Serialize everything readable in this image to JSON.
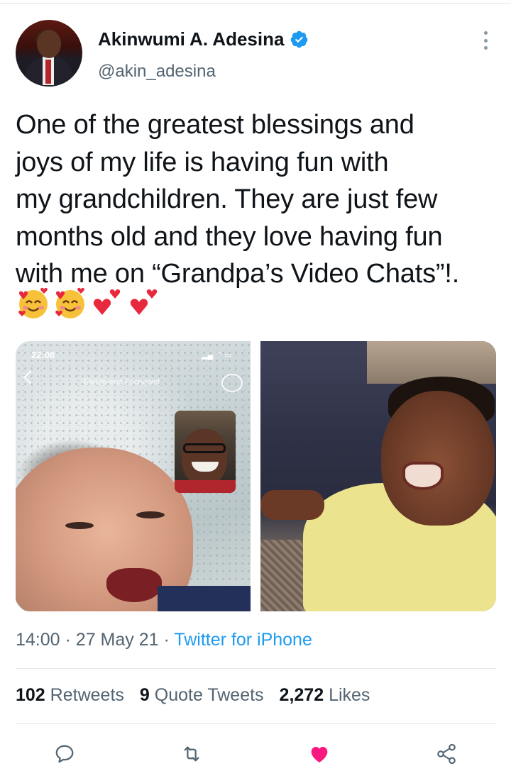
{
  "author": {
    "name": "Akinwumi A. Adesina",
    "handle": "@akin_adesina",
    "verified": true
  },
  "tweet": {
    "lines": [
      "One of the greatest blessings and",
      "joys of my life is having fun with",
      "my grandchildren. They are just few",
      "months old and they love having fun",
      "with me on “Grandpa’s Video Chats”!."
    ],
    "emojis": [
      "smiling-face-with-hearts",
      "smiling-face-with-hearts",
      "two-hearts",
      "two-hearts"
    ]
  },
  "media": {
    "screenshot": {
      "status_time": "22:08",
      "encryption_label": "End-to-end Encrypted"
    }
  },
  "meta": {
    "time": "14:00",
    "separator": "·",
    "date": "27 May 21",
    "source": "Twitter for iPhone"
  },
  "stats": {
    "retweets": {
      "count": "102",
      "label": "Retweets"
    },
    "quotes": {
      "count": "9",
      "label": "Quote Tweets"
    },
    "likes": {
      "count": "2,272",
      "label": "Likes"
    }
  },
  "colors": {
    "accent": "#1d9bf0",
    "like": "#f91880",
    "muted": "#536471"
  }
}
